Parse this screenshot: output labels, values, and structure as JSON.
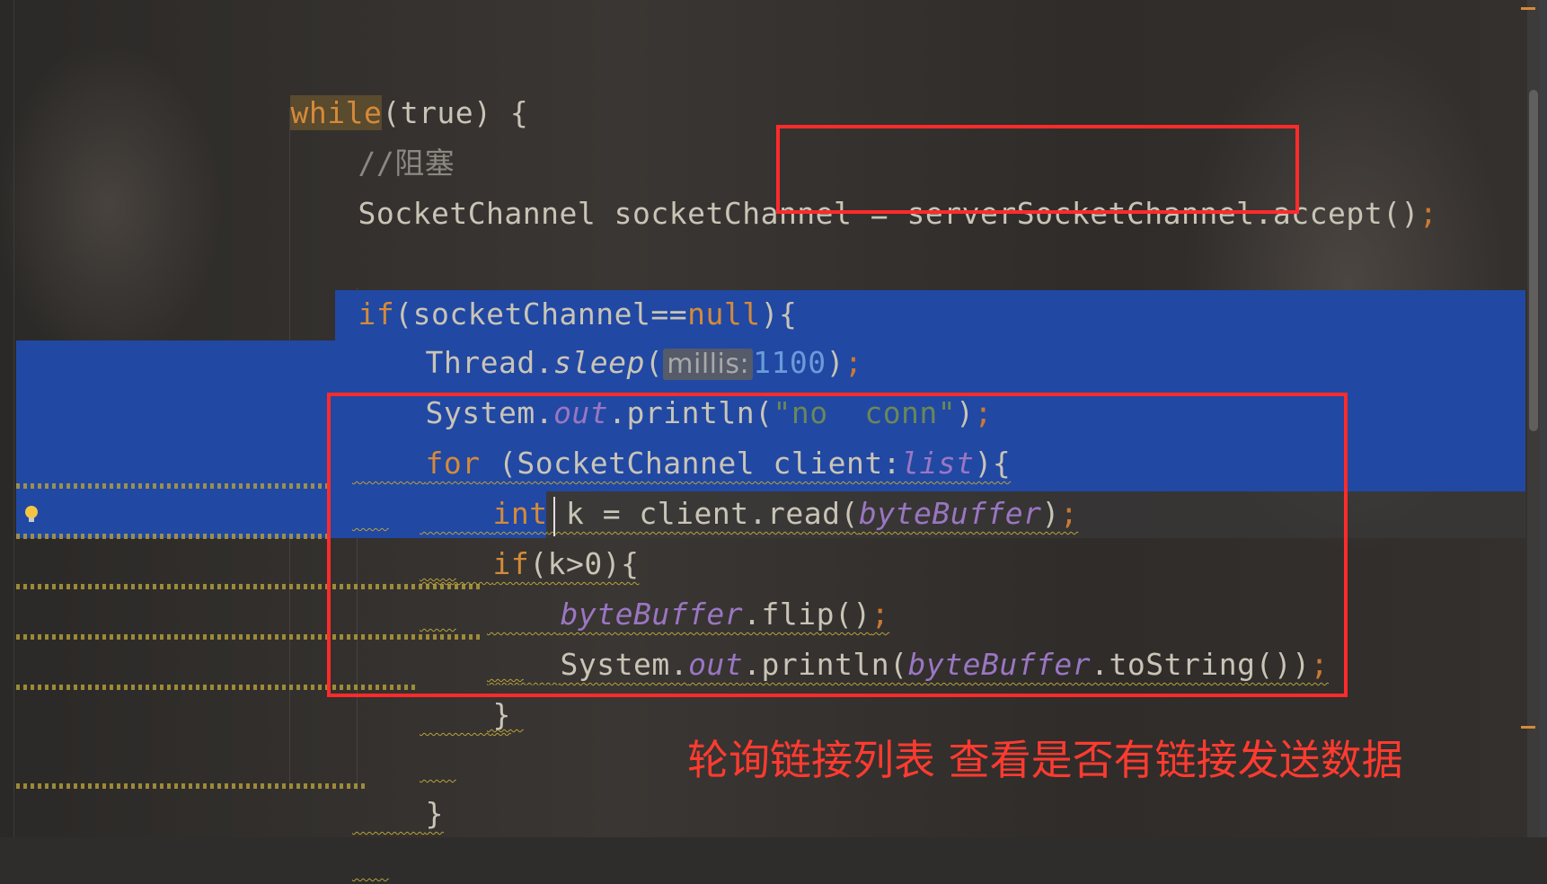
{
  "code": {
    "while_kw": "while",
    "while_rest": "(true) {",
    "comment": "//阻塞",
    "accept_lhs": "SocketChannel socketChannel = ",
    "accept_call": "serverSocketChannel.accept()",
    "semicolon": ";",
    "if_kw": "if",
    "if_cond": "(socketChannel==",
    "null_kw": "null",
    "if_close": "){",
    "thread": "Thread.",
    "sleep": "sleep",
    "paren_open": "(",
    "millis_hint": "millis:",
    "millis_value": "1100",
    "paren_close_semi": ")",
    "system": "System.",
    "out": "out",
    "println": ".println(",
    "str_no_conn": "\"no  conn\"",
    "close_paren": ")",
    "for_kw": "for",
    "for_mid": " (SocketChannel client:",
    "list": "list",
    "for_close": "){",
    "int_kw": "int",
    "read_mid": " k = client.read(",
    "byteBuffer": "byteBuffer",
    "if2_kw": "if",
    "if2_cond": "(k>0){",
    "flip_call": ".flip()",
    "println2": ".println(",
    "tostring": ".toString())",
    "brace_close": "}"
  },
  "annotation": "轮询链接列表 查看是否有链接发送数据",
  "colors": {
    "keyword": "#d48a39",
    "selection": "#2148a3",
    "highlight_box": "#ff2b2b",
    "annotation": "#ff3b30"
  },
  "icons": [
    "intention-bulb-icon"
  ]
}
